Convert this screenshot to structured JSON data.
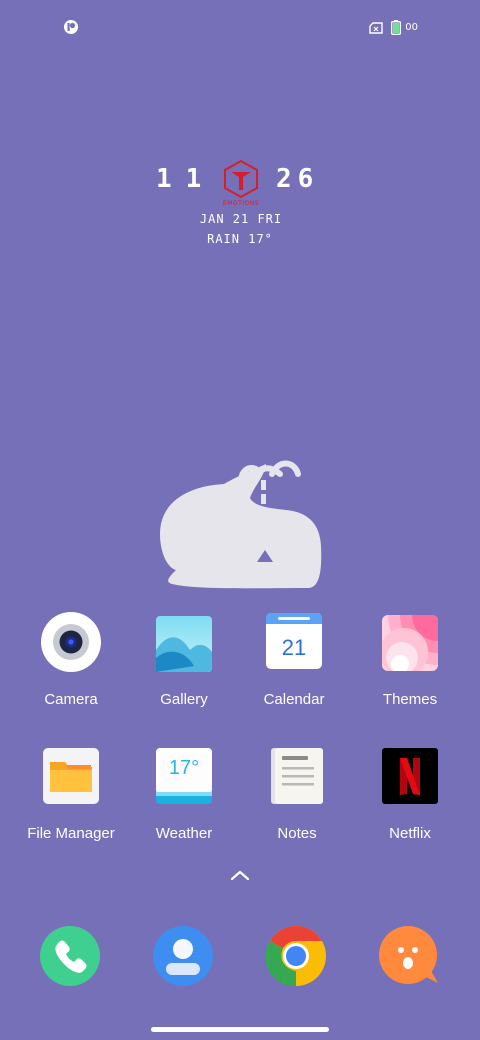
{
  "status_bar": {
    "battery_level": "00",
    "icons": [
      "notification-app-icon",
      "sim-card-icon",
      "battery-icon"
    ]
  },
  "clock_widget": {
    "hour": "11",
    "minute": "26",
    "logo_text": "EMOTIONS",
    "date": "JAN 21 FRI",
    "weather": "RAIN 17°"
  },
  "apps": [
    {
      "label": "Camera",
      "icon": "camera-icon"
    },
    {
      "label": "Gallery",
      "icon": "gallery-icon"
    },
    {
      "label": "Calendar",
      "icon": "calendar-icon",
      "badge": "21"
    },
    {
      "label": "Themes",
      "icon": "themes-icon"
    },
    {
      "label": "File Manager",
      "icon": "folder-icon"
    },
    {
      "label": "Weather",
      "icon": "weather-icon",
      "badge": "17°"
    },
    {
      "label": "Notes",
      "icon": "notes-icon"
    },
    {
      "label": "Netflix",
      "icon": "netflix-icon",
      "badge": "N"
    }
  ],
  "dock": [
    {
      "name": "Phone",
      "icon": "phone-icon"
    },
    {
      "name": "Contacts",
      "icon": "contacts-icon"
    },
    {
      "name": "Chrome",
      "icon": "chrome-icon"
    },
    {
      "name": "Messages",
      "icon": "messages-icon"
    }
  ],
  "colors": {
    "wallpaper": "#7670b8",
    "accent_red": "#d41f2a",
    "phone_green": "#3fcf8e",
    "contacts_blue": "#3d8ef0",
    "messages_orange": "#ff8a3d"
  }
}
